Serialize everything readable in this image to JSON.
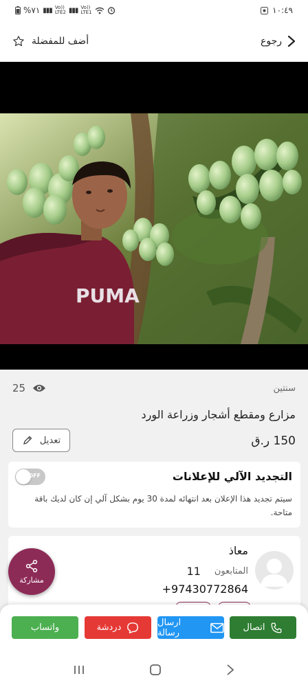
{
  "status_bar": {
    "time": "١٠:٤٩",
    "battery": "%٧١",
    "network_1": "LTE1",
    "network_2": "LTE2",
    "volte": "Vo))"
  },
  "top_bar": {
    "back_label": "رجوع",
    "favorite_label": "أضف للمفضلة"
  },
  "listing": {
    "age": "سنتين",
    "views": "25",
    "title": "مزارع ومقطع أشجار وزراعة الورد",
    "price": "150 ر.ق",
    "edit_label": "تعديل",
    "shirt_text": "PUMA"
  },
  "auto_renew": {
    "title": "التجديد الآلي للإعلانات",
    "description": "سيتم تجديد هذا الإعلان بعد انتهائه لمدة 30 يوم بشكل آلي إن كان لديك باقة متاحة.",
    "toggle_state": "OFF"
  },
  "seller": {
    "name": "معاذ",
    "followers_label": "المتابعون",
    "followers_count": "11",
    "phone": "+97430772864"
  },
  "share_label": "مشاركة",
  "actions": {
    "call": "اتصال",
    "message": "ارسال رسالة",
    "chat": "دردشة",
    "whatsapp": "واتساب"
  },
  "colors": {
    "share_bg": "#8d2b57",
    "call": "#2e7d32",
    "message": "#2196f3",
    "chat": "#e53935",
    "whatsapp": "#4caf50"
  }
}
